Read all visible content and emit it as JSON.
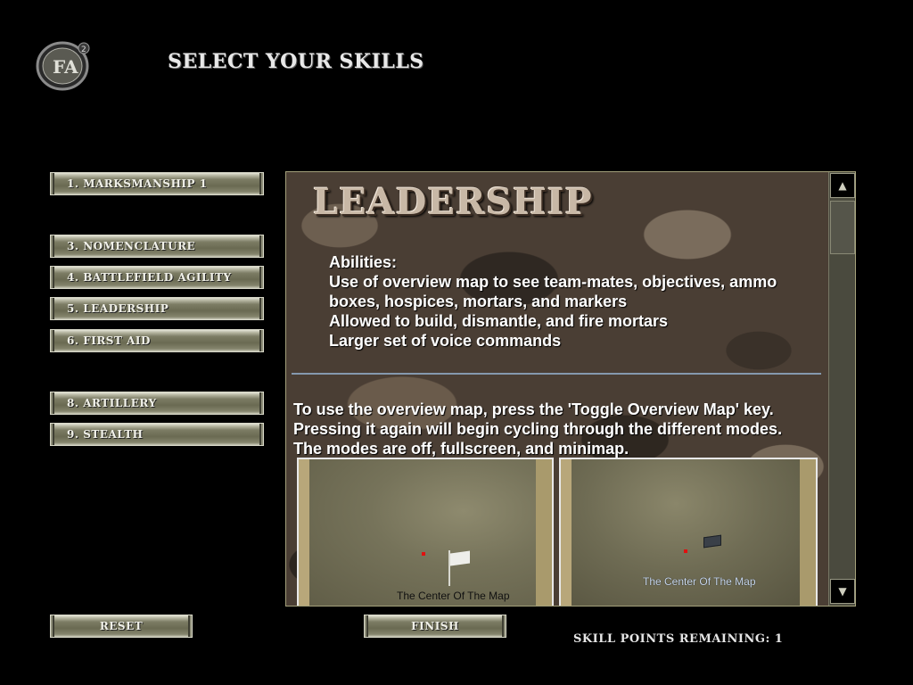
{
  "header": {
    "logo_icon": "fa2-emblem-icon",
    "title": "SELECT YOUR SKILLS"
  },
  "skills": [
    {
      "label": "1. MARKSMANSHIP 1"
    },
    {
      "label": "3. NOMENCLATURE"
    },
    {
      "label": "4. BATTLEFIELD AGILITY"
    },
    {
      "label": "5. LEADERSHIP"
    },
    {
      "label": "6. FIRST AID"
    },
    {
      "label": "8. ARTILLERY"
    },
    {
      "label": "9. STEALTH"
    }
  ],
  "detail": {
    "heading": "LEADERSHIP",
    "abilities_title": "Abilities:",
    "abilities_lines": [
      "Use of overview map to see team-mates, objectives, ammo",
      "boxes, hospices, mortars, and markers",
      "Allowed to build, dismantle, and fire mortars",
      "Larger set of voice commands"
    ],
    "instruction_lines": [
      "To use the overview map, press the 'Toggle Overview Map' key.",
      "Pressing it again will begin cycling through the different modes.",
      "The modes are off, fullscreen, and minimap."
    ],
    "screenshot_left_caption": "The Center Of The Map",
    "screenshot_right_caption": "The Center Of The Map"
  },
  "scrollbar": {
    "up_icon": "arrow-up-icon",
    "down_icon": "arrow-down-icon"
  },
  "footer": {
    "reset_label": "RESET",
    "finish_label": "FINISH",
    "skill_points_text": "SKILL POINTS REMAINING: 1"
  },
  "colors": {
    "background": "#000000",
    "button_face": "#6a6a52",
    "panel_border": "#a3a07a",
    "divider": "#8fa9c4"
  }
}
